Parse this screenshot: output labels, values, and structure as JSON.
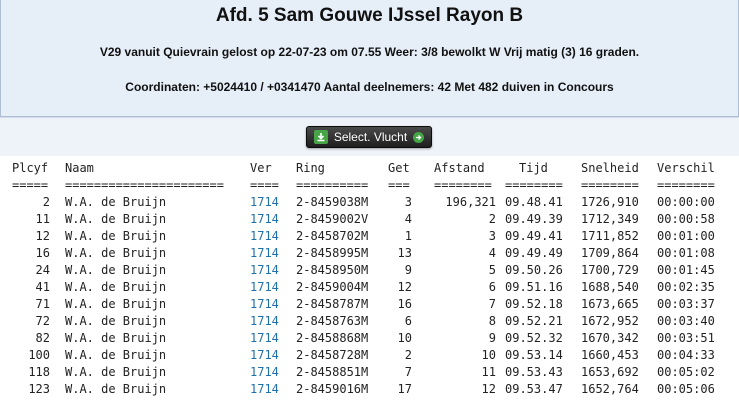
{
  "header": {
    "title": "Afd. 5 Sam Gouwe IJssel Rayon B",
    "line1": "V29 vanuit Quievrain gelost op 22-07-23 om 07.55 Weer: 3/8 bewolkt W Vrij matig (3) 16 graden.",
    "line2": "Coordinaten: +5024410 / +0341470 Aantal deelnemers: 42 Met 482 duiven in Concours"
  },
  "toolbar": {
    "select_label": "Select. Vlucht"
  },
  "table": {
    "columns": {
      "plcyf": "Plcyf",
      "naam": "Naam",
      "ver": "Ver",
      "ring": "Ring",
      "get": "Get",
      "afstand": "Afstand",
      "tijd": "Tijd",
      "snelheid": "Snelheid",
      "verschil": "Verschil"
    },
    "separators": {
      "plcyf": "=====",
      "naam": "======================",
      "ver": "====",
      "ring": "==========",
      "get": "===",
      "afstand": "========",
      "tijd": "========",
      "snelheid": "========",
      "verschil": "========"
    },
    "rows": [
      {
        "plcyf": "2",
        "naam": "W.A. de Bruijn",
        "ver": "1714",
        "ring": "2-8459038M",
        "get": "3",
        "afstand": "196,321",
        "tijd": "09.48.41",
        "snelheid": "1726,910",
        "verschil": "00:00:00"
      },
      {
        "plcyf": "11",
        "naam": "W.A. de Bruijn",
        "ver": "1714",
        "ring": "2-8459002V",
        "get": "4",
        "afstand": "2",
        "tijd": "09.49.39",
        "snelheid": "1712,349",
        "verschil": "00:00:58"
      },
      {
        "plcyf": "12",
        "naam": "W.A. de Bruijn",
        "ver": "1714",
        "ring": "2-8458702M",
        "get": "1",
        "afstand": "3",
        "tijd": "09.49.41",
        "snelheid": "1711,852",
        "verschil": "00:01:00"
      },
      {
        "plcyf": "16",
        "naam": "W.A. de Bruijn",
        "ver": "1714",
        "ring": "2-8458995M",
        "get": "13",
        "afstand": "4",
        "tijd": "09.49.49",
        "snelheid": "1709,864",
        "verschil": "00:01:08"
      },
      {
        "plcyf": "24",
        "naam": "W.A. de Bruijn",
        "ver": "1714",
        "ring": "2-8458950M",
        "get": "9",
        "afstand": "5",
        "tijd": "09.50.26",
        "snelheid": "1700,729",
        "verschil": "00:01:45"
      },
      {
        "plcyf": "41",
        "naam": "W.A. de Bruijn",
        "ver": "1714",
        "ring": "2-8459004M",
        "get": "12",
        "afstand": "6",
        "tijd": "09.51.16",
        "snelheid": "1688,540",
        "verschil": "00:02:35"
      },
      {
        "plcyf": "71",
        "naam": "W.A. de Bruijn",
        "ver": "1714",
        "ring": "2-8458787M",
        "get": "16",
        "afstand": "7",
        "tijd": "09.52.18",
        "snelheid": "1673,665",
        "verschil": "00:03:37"
      },
      {
        "plcyf": "72",
        "naam": "W.A. de Bruijn",
        "ver": "1714",
        "ring": "2-8458763M",
        "get": "6",
        "afstand": "8",
        "tijd": "09.52.21",
        "snelheid": "1672,952",
        "verschil": "00:03:40"
      },
      {
        "plcyf": "82",
        "naam": "W.A. de Bruijn",
        "ver": "1714",
        "ring": "2-8458868M",
        "get": "10",
        "afstand": "9",
        "tijd": "09.52.32",
        "snelheid": "1670,342",
        "verschil": "00:03:51"
      },
      {
        "plcyf": "100",
        "naam": "W.A. de Bruijn",
        "ver": "1714",
        "ring": "2-8458728M",
        "get": "2",
        "afstand": "10",
        "tijd": "09.53.14",
        "snelheid": "1660,453",
        "verschil": "00:04:33"
      },
      {
        "plcyf": "118",
        "naam": "W.A. de Bruijn",
        "ver": "1714",
        "ring": "2-8458851M",
        "get": "7",
        "afstand": "11",
        "tijd": "09.53.43",
        "snelheid": "1653,692",
        "verschil": "00:05:02"
      },
      {
        "plcyf": "123",
        "naam": "W.A. de Bruijn",
        "ver": "1714",
        "ring": "2-8459016M",
        "get": "17",
        "afstand": "12",
        "tijd": "09.53.47",
        "snelheid": "1652,764",
        "verschil": "00:05:06"
      }
    ]
  },
  "colors": {
    "header_bg": "#e6eef8",
    "link_blue": "#1f6fa8",
    "button_dark": "#2a2a2a",
    "icon_green": "#47a447"
  },
  "icons": {
    "download": "download-icon",
    "arrow": "arrow-right-icon"
  }
}
